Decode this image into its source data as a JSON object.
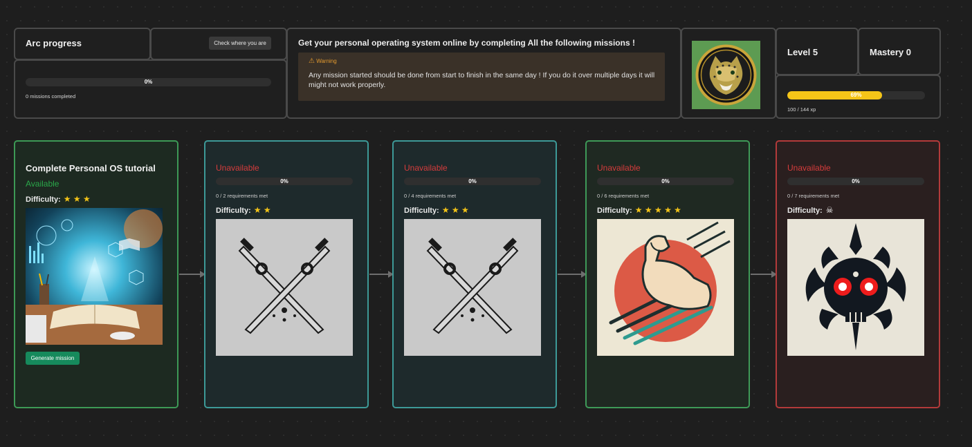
{
  "arc": {
    "title": "Arc progress",
    "check_button": "Check where you are",
    "progress_label": "0%",
    "progress_value": 0,
    "missions_completed": "0 missions completed"
  },
  "intro": {
    "heading": "Get your personal operating system online by completing All the following missions !",
    "warning_title": "Warning",
    "warning_text": "Any mission started should be done from start to finish in the same day ! If you do it over multiple days it will might not work properly."
  },
  "profile": {
    "avatar_icon": "jaguar-emblem-icon",
    "level": "Level 5",
    "mastery": "Mastery 0",
    "xp_label": "69%",
    "xp_value": 0.69,
    "xp_text": "100 / 144 xp"
  },
  "missions": [
    {
      "title": "Complete Personal OS tutorial",
      "status": "Available",
      "difficulty_label": "Difficulty:",
      "stars": "★ ★ ★",
      "image_icon": "open-book-tech-illustration",
      "button": "Generate mission"
    },
    {
      "status": "Unavailable",
      "progress_label": "0%",
      "requirements": "0 / 2 requirements met",
      "difficulty_label": "Difficulty:",
      "stars": "★ ★",
      "image_icon": "crossed-swords-icon"
    },
    {
      "status": "Unavailable",
      "progress_label": "0%",
      "requirements": "0 / 4 requirements met",
      "difficulty_label": "Difficulty:",
      "stars": "★ ★ ★",
      "image_icon": "crossed-swords-icon"
    },
    {
      "status": "Unavailable",
      "progress_label": "0%",
      "requirements": "0 / 6 requirements met",
      "difficulty_label": "Difficulty:",
      "stars": "★ ★ ★ ★ ★",
      "image_icon": "flexed-arm-icon"
    },
    {
      "status": "Unavailable",
      "progress_label": "0%",
      "requirements": "0 / 7 requirements met",
      "difficulty_label": "Difficulty:",
      "stars": "☠",
      "image_icon": "skull-emblem-icon"
    }
  ],
  "colors": {
    "available": "#2aa84a",
    "unavailable": "#d63c3c",
    "xp_fill": "#f5c518",
    "button_green": "#168a5c",
    "warning": "#e39a2f"
  }
}
